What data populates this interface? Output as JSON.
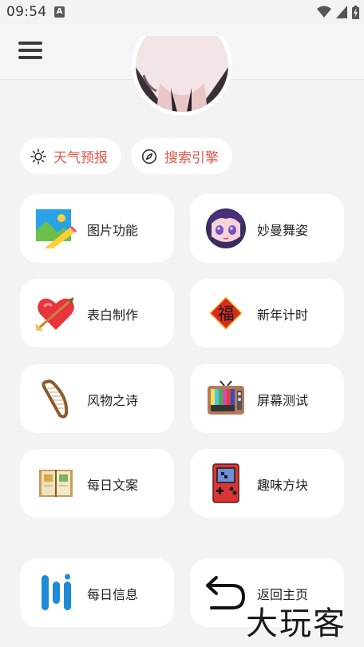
{
  "status_bar": {
    "time": "09:54",
    "notification_badge": "A"
  },
  "chips": [
    {
      "label": "天气预报",
      "icon": "sun-icon"
    },
    {
      "label": "搜索引擎",
      "icon": "compass-icon"
    }
  ],
  "cards": [
    {
      "label": "图片功能",
      "icon": "picture-icon"
    },
    {
      "label": "妙曼舞姿",
      "icon": "anime-avatar-icon"
    },
    {
      "label": "表白制作",
      "icon": "heart-arrow-icon"
    },
    {
      "label": "新年计时",
      "icon": "fu-icon"
    },
    {
      "label": "风物之诗",
      "icon": "harp-icon"
    },
    {
      "label": "屏幕测试",
      "icon": "tv-icon"
    },
    {
      "label": "每日文案",
      "icon": "book-icon"
    },
    {
      "label": "趣味方块",
      "icon": "game-console-icon"
    },
    {
      "label": "每日信息",
      "icon": "bars-logo-icon"
    },
    {
      "label": "返回主页",
      "icon": "back-arrow-icon"
    }
  ],
  "fu_character": "福",
  "watermark": "大玩客",
  "colors": {
    "accent": "#e0564a",
    "background": "#f3f3f6",
    "card": "#ffffff"
  }
}
